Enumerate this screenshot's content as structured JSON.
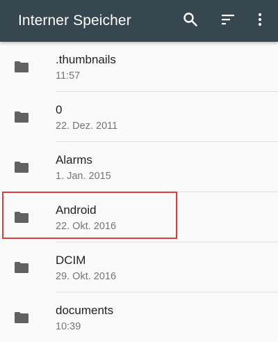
{
  "appbar": {
    "title": "Interner Speicher",
    "background": "#37474f",
    "actions": [
      {
        "icon": "search-icon"
      },
      {
        "icon": "sort-icon"
      },
      {
        "icon": "more-vert-icon"
      }
    ]
  },
  "files": [
    {
      "name": ".thumbnails",
      "date": "11:57",
      "icon": "folder-icon"
    },
    {
      "name": "0",
      "date": "22. Dez. 2011",
      "icon": "folder-icon"
    },
    {
      "name": "Alarms",
      "date": "1. Jan. 2015",
      "icon": "folder-icon"
    },
    {
      "name": "Android",
      "date": "22. Okt. 2016",
      "icon": "folder-icon",
      "highlighted": true
    },
    {
      "name": "DCIM",
      "date": "29. Okt. 2016",
      "icon": "folder-icon"
    },
    {
      "name": "documents",
      "date": "10:39",
      "icon": "folder-icon"
    }
  ],
  "colors": {
    "folder": "#616161",
    "highlight": "#e53935",
    "name_text": "#212121",
    "date_text": "#757575"
  }
}
